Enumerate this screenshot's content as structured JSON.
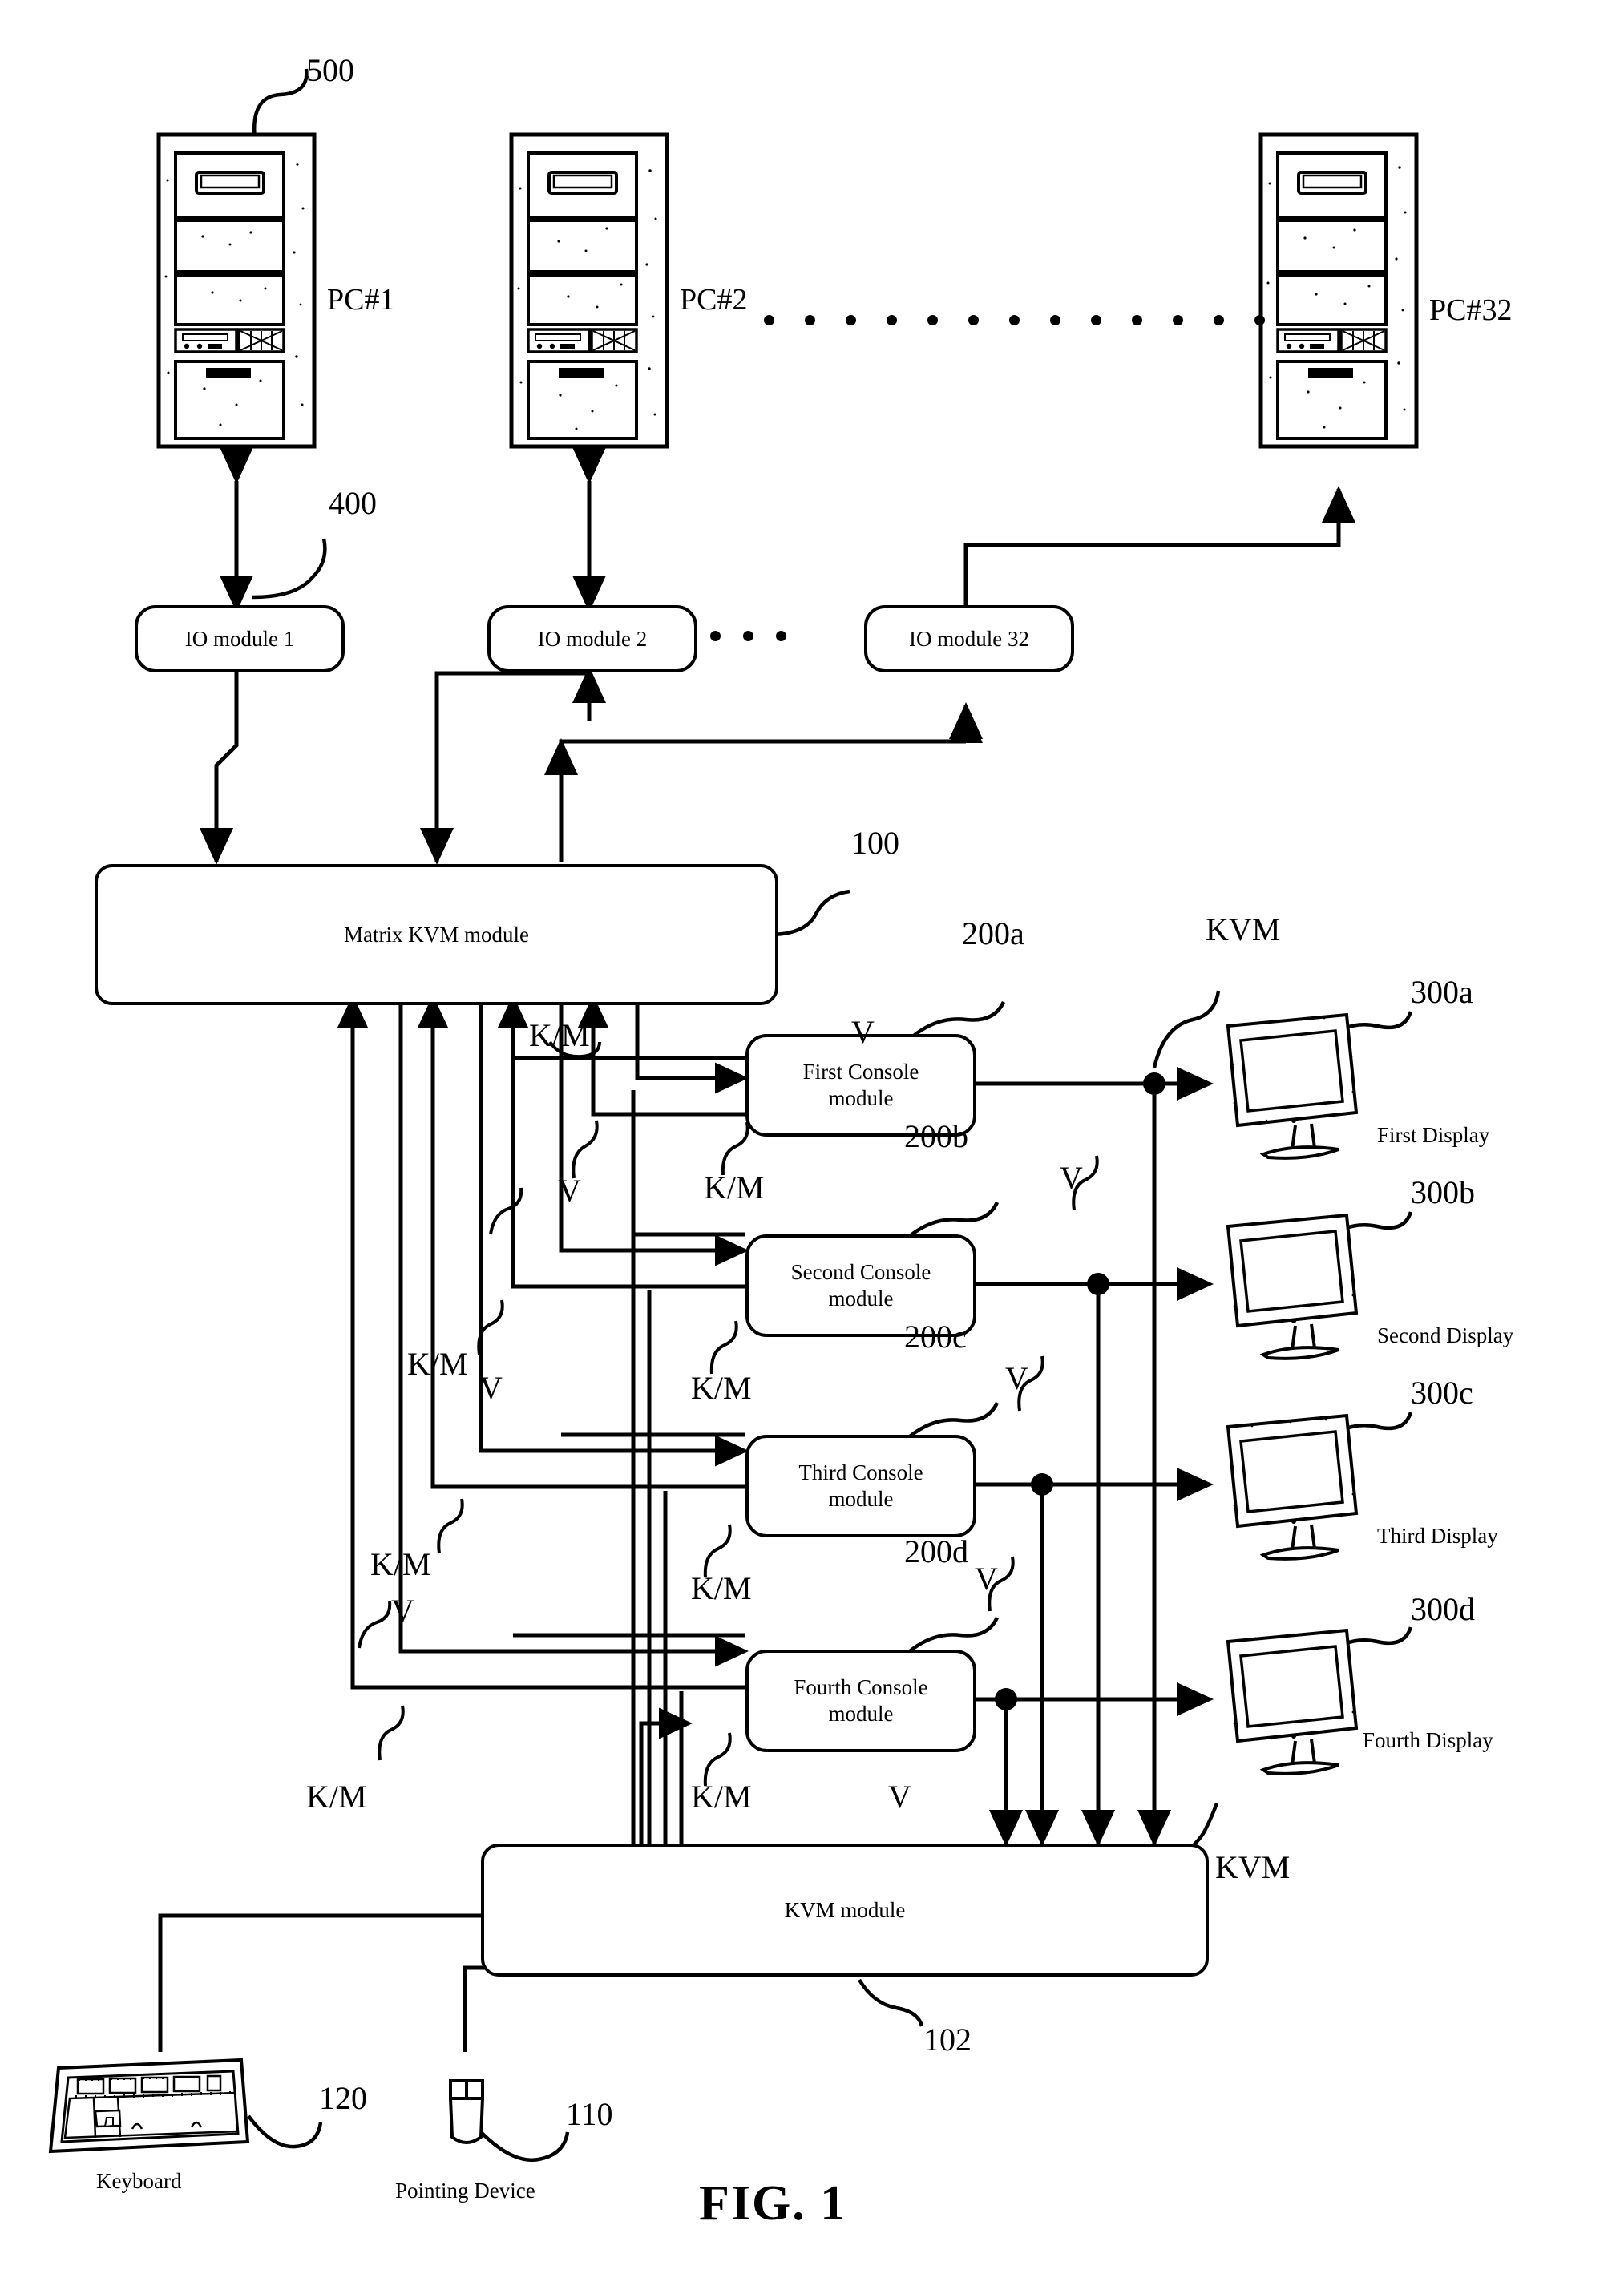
{
  "figure": {
    "caption": "FIG. 1",
    "type": "patent-block-diagram"
  },
  "computers": {
    "ref": "500",
    "items": [
      {
        "name": "PC#1"
      },
      {
        "name": "PC#2"
      },
      {
        "name": "PC#32"
      }
    ],
    "ellipsis_dots": 13
  },
  "io_modules": {
    "ref": "400",
    "items": [
      {
        "label": "IO module 1"
      },
      {
        "label": "IO module 2"
      },
      {
        "label": "IO module 32"
      }
    ],
    "ellipsis_dots": 3
  },
  "matrix": {
    "ref": "100",
    "label": "Matrix KVM module"
  },
  "consoles": {
    "items": [
      {
        "ref": "200a",
        "line1": "First Console",
        "line2": "module"
      },
      {
        "ref": "200b",
        "line1": "Second Console",
        "line2": "module"
      },
      {
        "ref": "200c",
        "line1": "Third Console",
        "line2": "module"
      },
      {
        "ref": "200d",
        "line1": "Fourth Console",
        "line2": "module"
      }
    ]
  },
  "displays": {
    "items": [
      {
        "ref": "300a",
        "name": "First Display"
      },
      {
        "ref": "300b",
        "name": "Second Display"
      },
      {
        "ref": "300c",
        "name": "Third Display"
      },
      {
        "ref": "300d",
        "name": "Fourth Display"
      }
    ]
  },
  "kvm_module": {
    "ref": "102",
    "label": "KVM module"
  },
  "peripherals": {
    "keyboard": {
      "ref": "120",
      "name": "Keyboard"
    },
    "pointing_device": {
      "ref": "110",
      "name": "Pointing Device"
    }
  },
  "signal_labels": {
    "video": "V",
    "keyboard_mouse": "K/M",
    "kvm": "KVM"
  },
  "annotations": {
    "km_1": "K/M",
    "km_2": "K/M",
    "km_3": "K/M",
    "km_4": "K/M",
    "km_5": "K/M",
    "km_6": "K/M",
    "km_7": "K/M",
    "km_8": "K/M",
    "v_1": "V",
    "v_2": "V",
    "v_3": "V",
    "v_4": "V",
    "v_5": "V",
    "v_6": "V",
    "v_7": "V",
    "v_8": "V",
    "kvm_top": "KVM",
    "kvm_bottom": "KVM"
  }
}
